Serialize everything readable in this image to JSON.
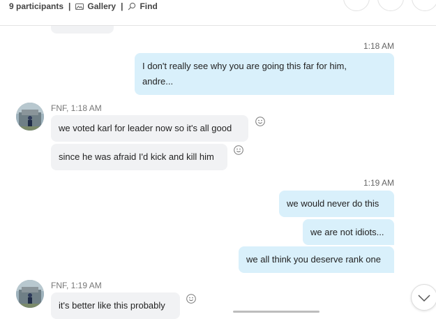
{
  "header": {
    "participants": "9 participants",
    "separator": "|",
    "gallery": "Gallery",
    "find": "Find"
  },
  "messages": {
    "out1": {
      "time": "1:18 AM",
      "text_line1": "I don't really see why you are going this far for him,",
      "text_line2": "andre..."
    },
    "in1": {
      "sender": "FNF, 1:18 AM",
      "bubble1": "we voted karl for leader now so it's all good",
      "bubble2": "since he was afraid I'd kick and kill him"
    },
    "out2": {
      "time": "1:19 AM",
      "bubble1": "we would never do this",
      "bubble2": "we are not idiots...",
      "bubble3": "we all think you deserve rank one"
    },
    "in2": {
      "sender": "FNF, 1:19 AM",
      "bubble1": "it's better like this probably"
    }
  },
  "colors": {
    "outgoing_bubble": "#d9f0fb",
    "incoming_bubble": "#f1f2f4"
  },
  "icons": {
    "gallery": "gallery-icon",
    "find": "search-icon",
    "reaction": "smiley-icon",
    "scroll_down": "chevron-down-icon"
  }
}
